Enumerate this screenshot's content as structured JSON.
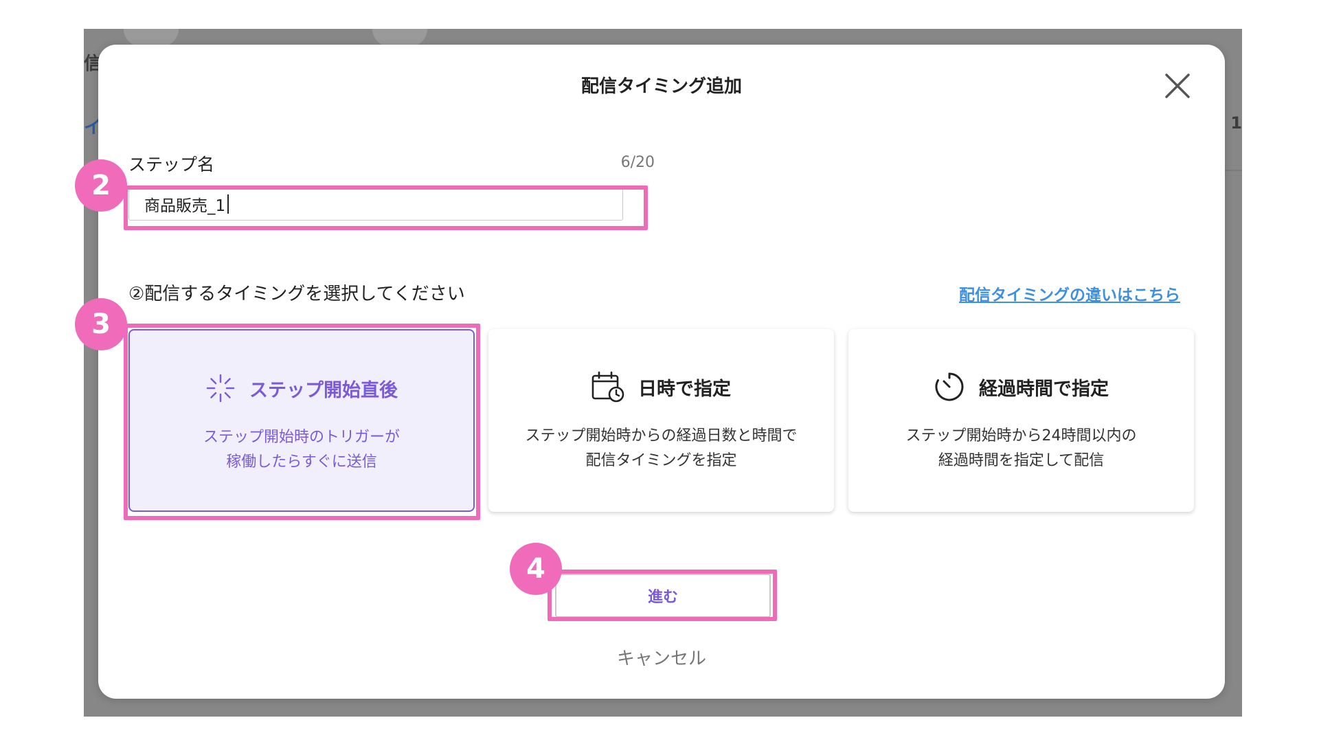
{
  "background": {
    "fragments": [
      "信",
      "イ",
      "/ 1"
    ]
  },
  "modal": {
    "title": "配信タイミング追加",
    "close_icon": "close-icon"
  },
  "step_name": {
    "label": "ステップ名",
    "count": "6/20",
    "value": "商品販売_1"
  },
  "timing": {
    "section_label": "②配信するタイミングを選択してください",
    "help_link": "配信タイミングの違いはこちら",
    "options": [
      {
        "title": "ステップ開始直後",
        "desc_line1": "ステップ開始時のトリガーが",
        "desc_line2": "稼働したらすぐに送信",
        "icon": "loading-sparkle-icon",
        "selected": true
      },
      {
        "title": "日時で指定",
        "desc_line1": "ステップ開始時からの経過日数と時間で",
        "desc_line2": "配信タイミングを指定",
        "icon": "calendar-clock-icon",
        "selected": false
      },
      {
        "title": "経過時間で指定",
        "desc_line1": "ステップ開始時から24時間以内の",
        "desc_line2": "経過時間を指定して配信",
        "icon": "timer-icon",
        "selected": false
      }
    ]
  },
  "actions": {
    "next_label": "進む",
    "cancel_label": "キャンセル"
  },
  "annotations": {
    "badge_2": "2",
    "badge_3": "3",
    "badge_4": "4"
  },
  "colors": {
    "accent": "#7a5ad8",
    "highlight": "#ef6ab8",
    "link": "#3f8fe0",
    "backdrop": "#878787"
  }
}
